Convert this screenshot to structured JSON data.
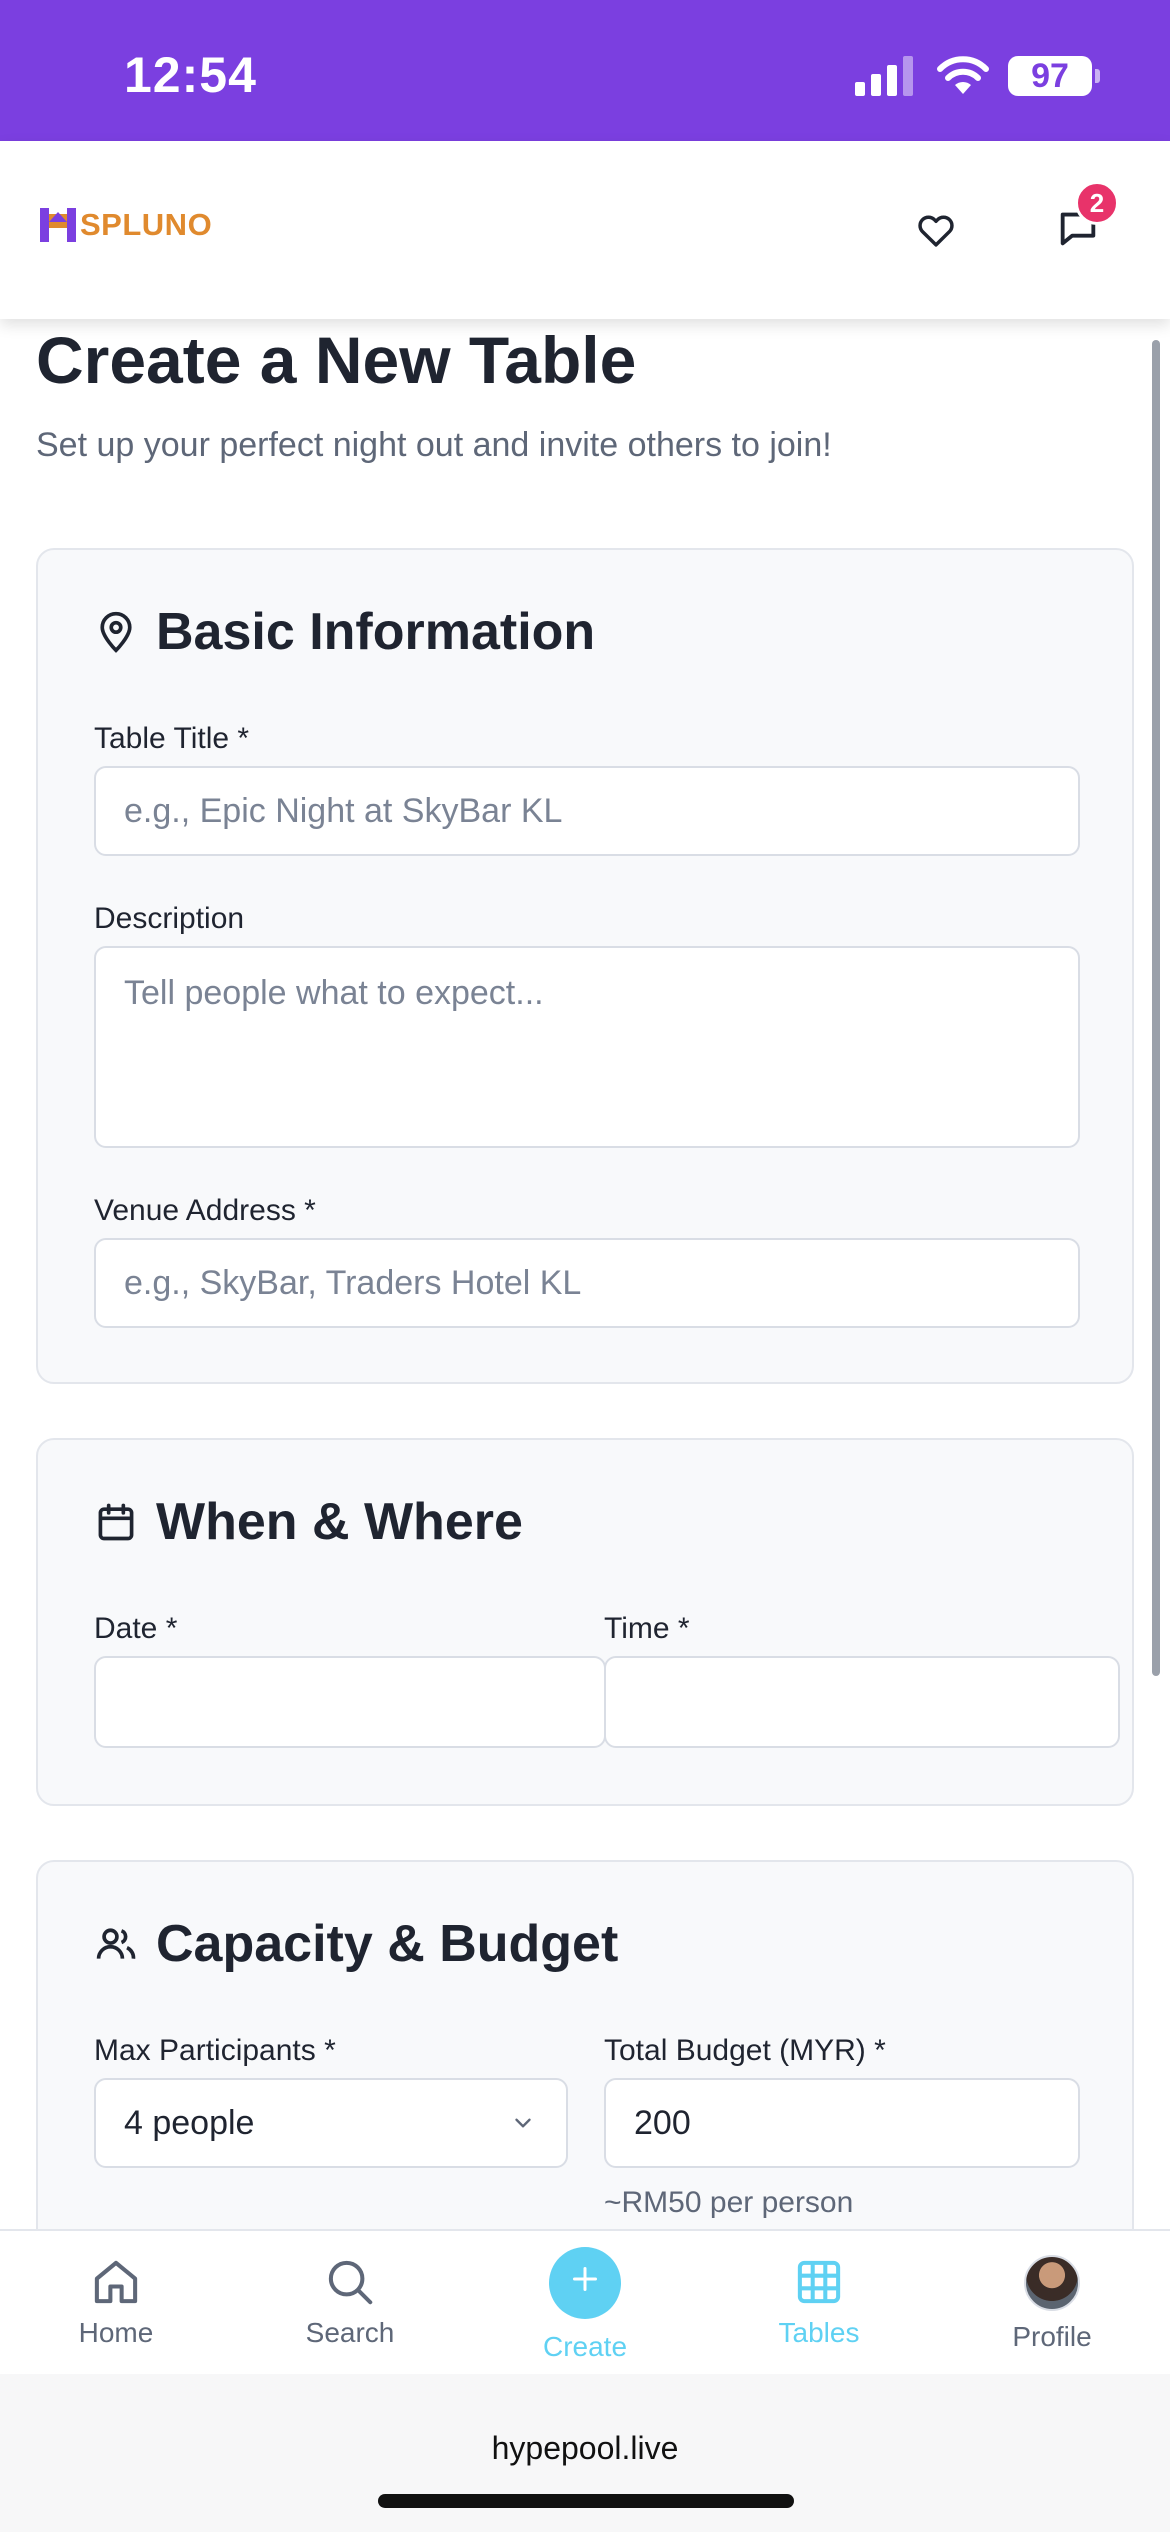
{
  "status": {
    "time": "12:54",
    "battery": "97"
  },
  "header": {
    "logo_text": "SPLUNO",
    "notification_count": "2"
  },
  "page": {
    "title": "Create a New Table",
    "subtitle": "Set up your perfect night out and invite others to join!"
  },
  "basic": {
    "title": "Basic Information",
    "table_title_label": "Table Title *",
    "table_title_placeholder": "e.g., Epic Night at SkyBar KL",
    "description_label": "Description",
    "description_placeholder": "Tell people what to expect...",
    "venue_label": "Venue Address *",
    "venue_placeholder": "e.g., SkyBar, Traders Hotel KL"
  },
  "when": {
    "title": "When & Where",
    "date_label": "Date *",
    "time_label": "Time *"
  },
  "capacity": {
    "title": "Capacity & Budget",
    "max_label": "Max Participants *",
    "max_value": "4 people",
    "budget_label": "Total Budget (MYR) *",
    "budget_value": "200",
    "per_person": "~RM50 per person"
  },
  "nav": {
    "home": "Home",
    "search": "Search",
    "create": "Create",
    "tables": "Tables",
    "profile": "Profile"
  },
  "browser": {
    "url": "hypepool.live"
  },
  "colors": {
    "brand_purple": "#7b3fe0",
    "accent_cyan": "#5fd1f3",
    "badge_pink": "#e8336a",
    "logo_orange": "#e08a2e"
  }
}
